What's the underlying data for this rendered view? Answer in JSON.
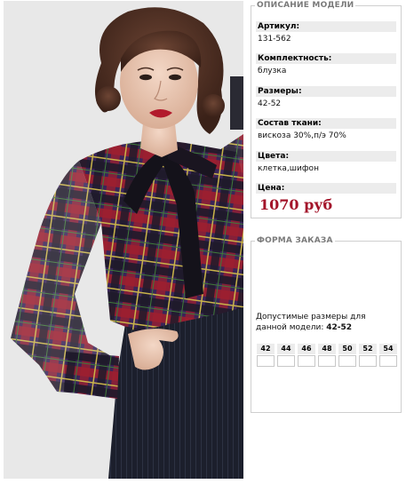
{
  "description": {
    "legend": "ОПИСАНИЕ МОДЕЛИ",
    "fields": [
      {
        "label": "Артикул:",
        "value": "131-562"
      },
      {
        "label": "Комплектность:",
        "value": "блузка"
      },
      {
        "label": "Размеры:",
        "value": "42-52"
      },
      {
        "label": "Состав ткани:",
        "value": "вискоза 30%,п/э 70%"
      },
      {
        "label": "Цвета:",
        "value": "клетка,шифон"
      },
      {
        "label": "Цена:",
        "value": "1070 руб"
      }
    ]
  },
  "order": {
    "legend": "ФОРМА ЗАКАЗА",
    "note_prefix": "Допустимые размеры для данной модели: ",
    "note_sizes": "42-52",
    "sizes": [
      "42",
      "44",
      "46",
      "48",
      "50",
      "52",
      "54"
    ]
  },
  "colors": {
    "price": "#a3142a",
    "label_bg": "#ececec",
    "border": "#cfcfcf"
  }
}
